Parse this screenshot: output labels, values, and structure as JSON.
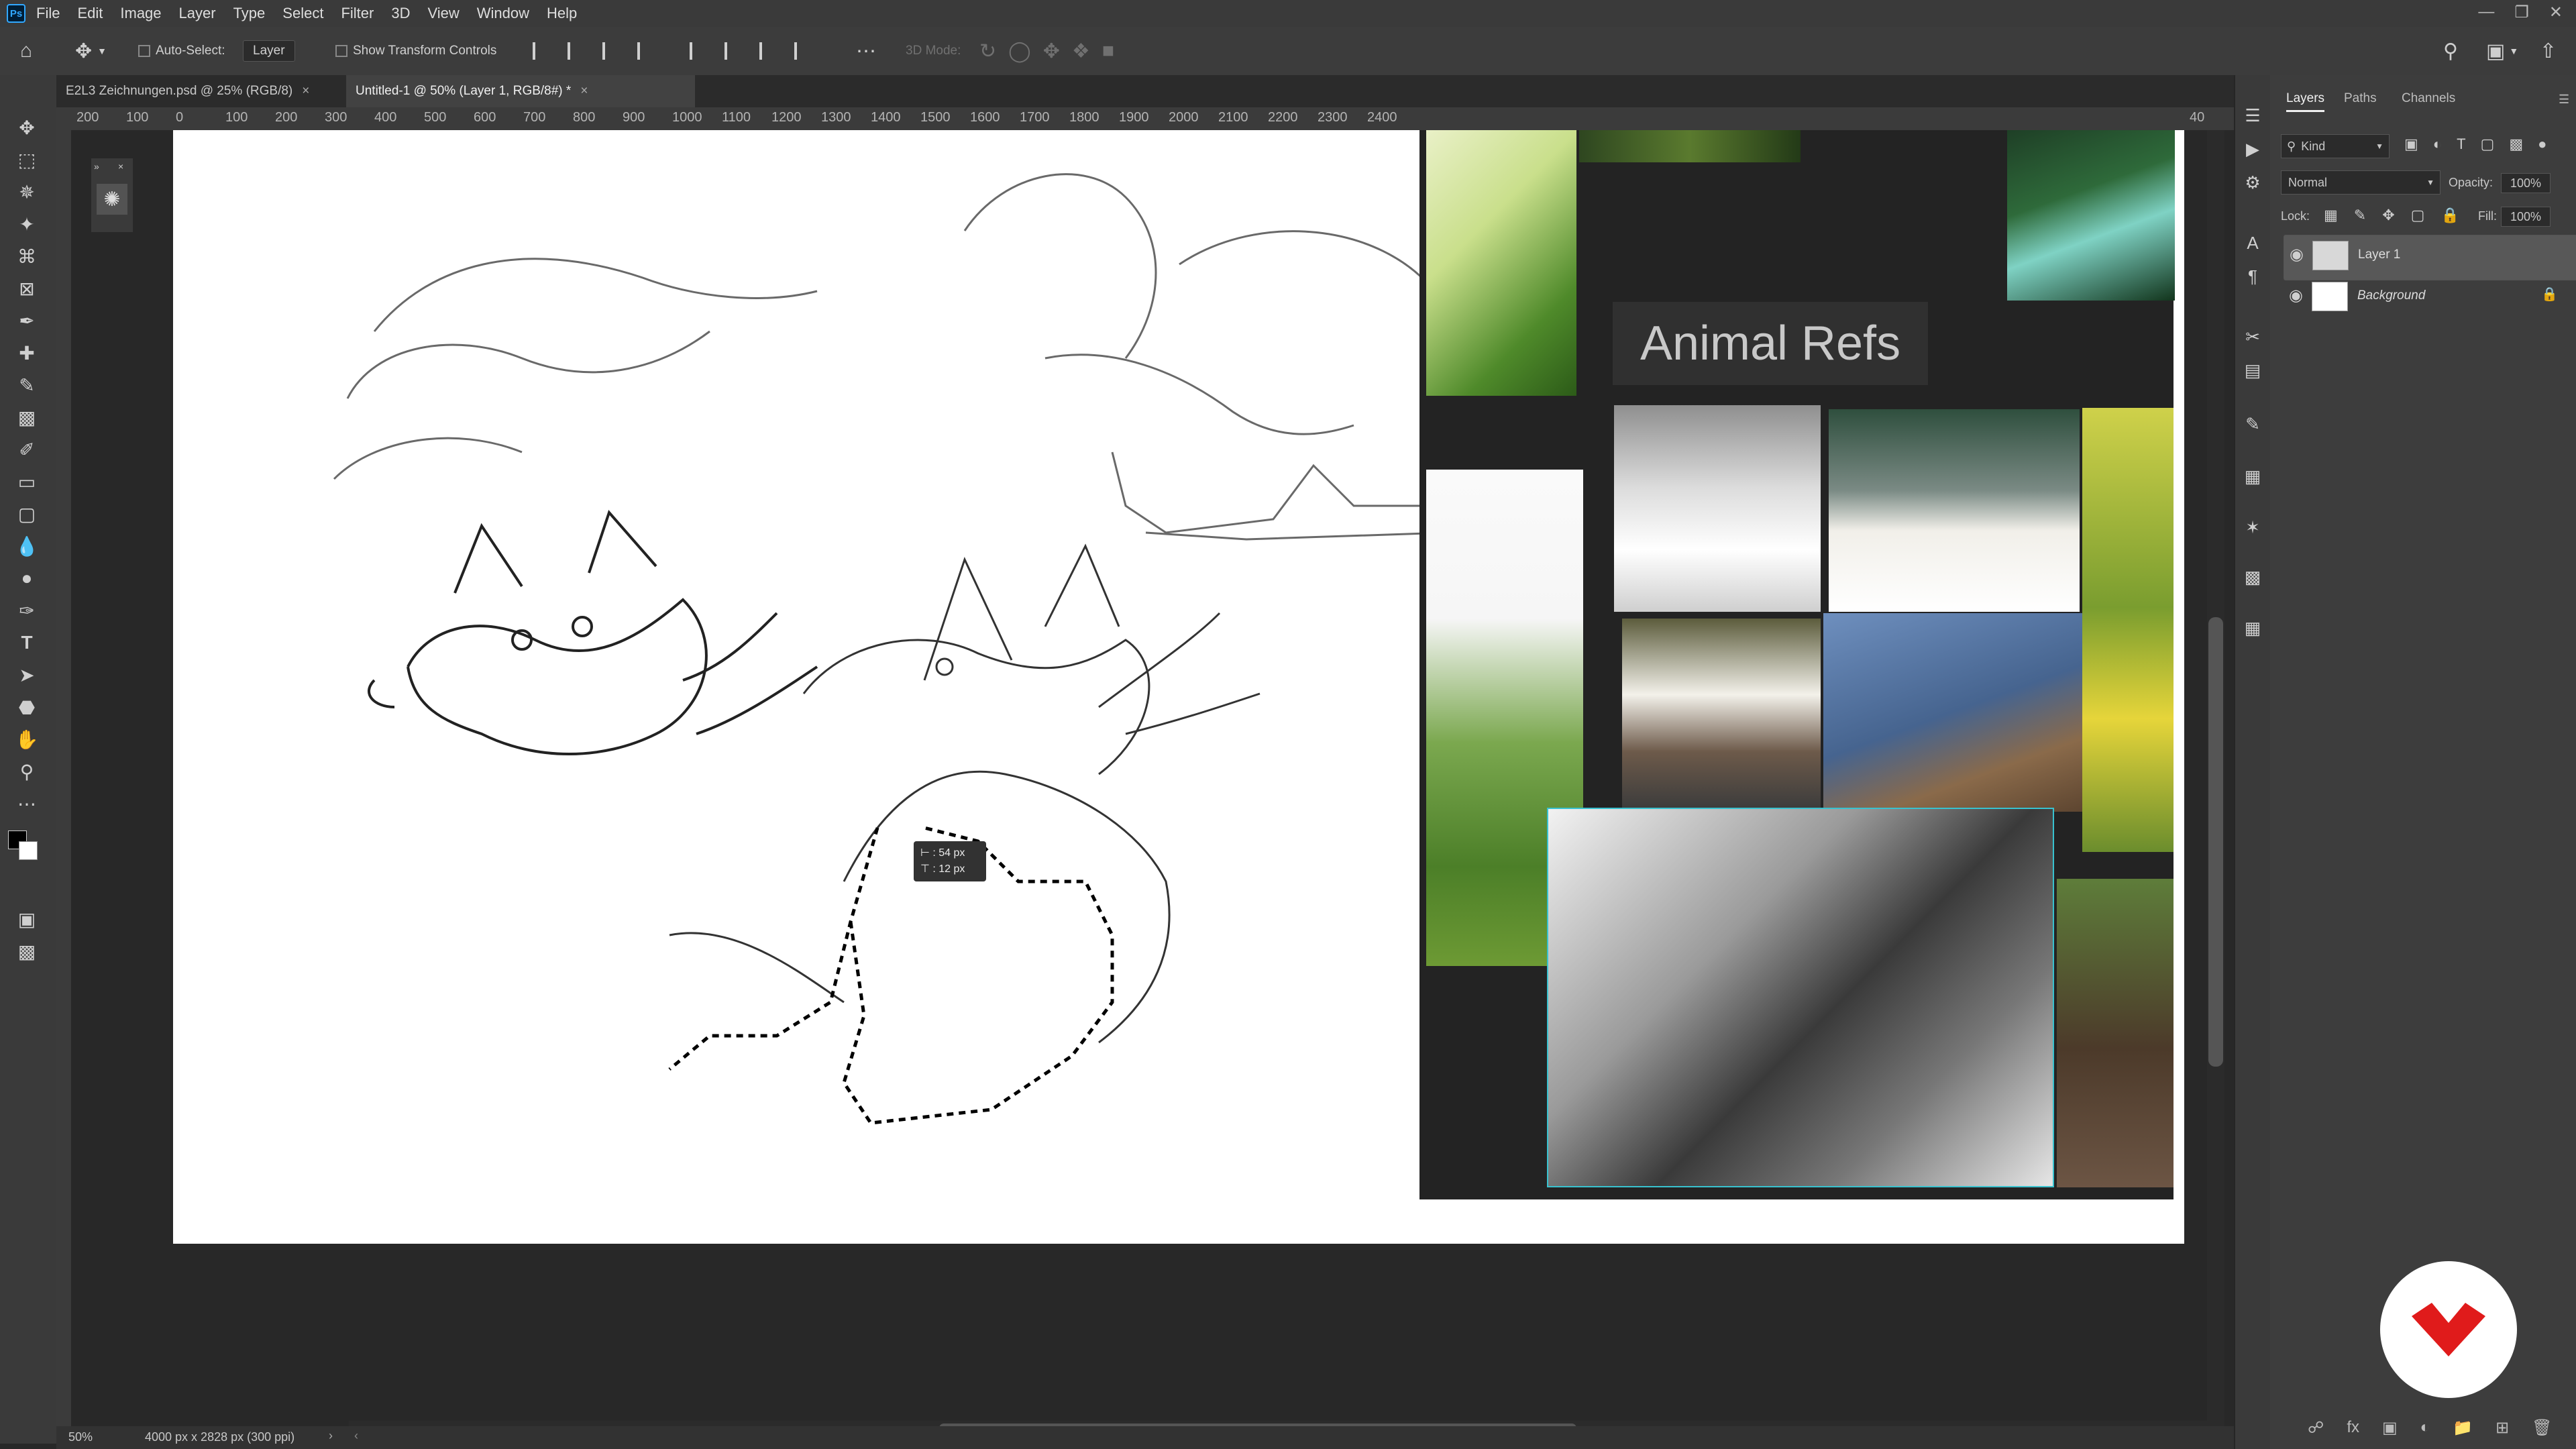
{
  "menubar": {
    "app_icon": "Ps",
    "items": [
      "File",
      "Edit",
      "Image",
      "Layer",
      "Type",
      "Select",
      "Filter",
      "3D",
      "View",
      "Window",
      "Help"
    ]
  },
  "options_bar": {
    "auto_select_label": "Auto-Select:",
    "auto_select_value": "Layer",
    "show_transform_label": "Show Transform Controls",
    "three_d_mode_label": "3D Mode:"
  },
  "tabs": [
    {
      "label": "E2L3 Zeichnungen.psd @ 25% (RGB/8)",
      "active": false
    },
    {
      "label": "Untitled-1 @ 50% (Layer 1, RGB/8#) *",
      "active": true
    }
  ],
  "ruler": {
    "top_ticks": [
      "200",
      "100",
      "0",
      "100",
      "200",
      "300",
      "400",
      "500",
      "600",
      "700",
      "800",
      "900",
      "1000",
      "1100",
      "1200",
      "1300",
      "1400",
      "1500",
      "1600",
      "1700",
      "1800",
      "1900",
      "2000",
      "2100",
      "2200",
      "2300",
      "2400"
    ],
    "right_tick": "40"
  },
  "canvas": {
    "moodboard_title": "Animal Refs",
    "tooltip_line1": "⊢ : 54 px",
    "tooltip_line2": "⊤ : 12 px"
  },
  "status": {
    "zoom": "50%",
    "doc_info": "4000 px x 2828 px (300 ppi)"
  },
  "layers_panel": {
    "tabs": [
      "Layers",
      "Paths",
      "Channels"
    ],
    "kind_label": "Kind",
    "blend_mode": "Normal",
    "opacity_label": "Opacity:",
    "opacity_value": "100%",
    "lock_label": "Lock:",
    "fill_label": "Fill:",
    "fill_value": "100%",
    "layers": [
      {
        "name": "Layer 1",
        "selected": true
      },
      {
        "name": "Background",
        "selected": false,
        "locked": true
      }
    ]
  },
  "colors": {
    "accent": "#31a8ff",
    "brand_logo": "#e01b1b"
  }
}
